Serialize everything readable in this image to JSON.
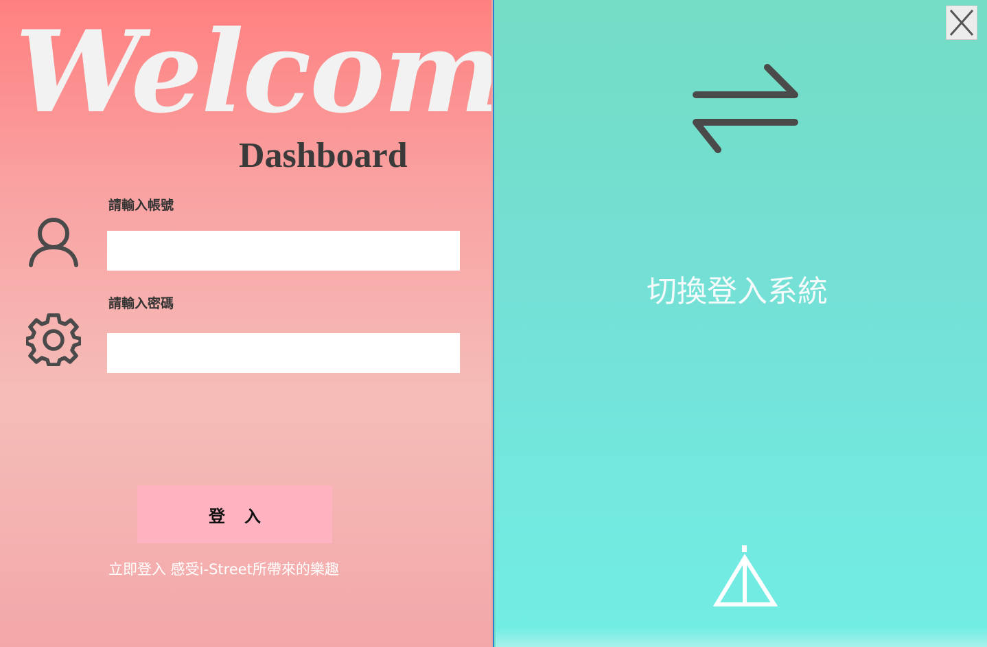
{
  "left_panel": {
    "welcome_text": "Welcome",
    "subtitle": "Dashboard",
    "username_label": "請輸入帳號",
    "username_value": "",
    "password_label": "請輸入密碼",
    "password_value": "",
    "login_label": "登入",
    "tagline": "立即登入  感受i-Street所帶來的樂趣",
    "icons": {
      "user": "user-icon",
      "settings": "gear-icon"
    }
  },
  "right_panel": {
    "switch_text": "切換登入系統",
    "icons": {
      "switch": "swap-arrows-icon",
      "logo": "tent-logo-icon",
      "close": "close-icon"
    }
  },
  "colors": {
    "left_top": "#ff8080",
    "left_bottom": "#f3a7a9",
    "right_top": "#74dcc4",
    "right_bottom": "#72ede4",
    "button_bg": "#ffb3c1",
    "icon_dark": "#4a4a4a"
  }
}
